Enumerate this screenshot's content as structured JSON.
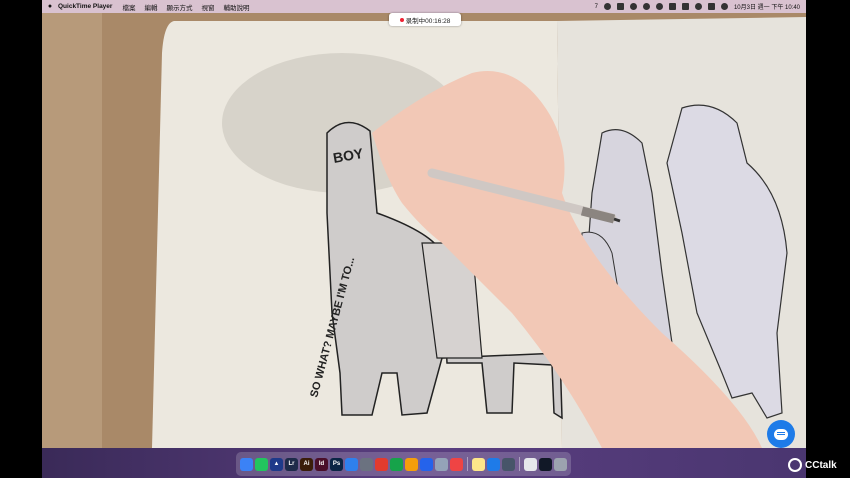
{
  "menubar": {
    "app_name": "QuickTime Player",
    "menus": [
      "檔案",
      "編輯",
      "顯示方式",
      "視窗",
      "輔助說明"
    ],
    "status_count": "7",
    "datetime": "10月3日 週一 下午 10:40"
  },
  "recording": {
    "label": "录制中00:16:28"
  },
  "drawing": {
    "lettering_top": "BOY",
    "lettering_side": "SO WHAT? MAYBE I'M TO..."
  },
  "dock": {
    "items": [
      {
        "name": "finder",
        "color": "#3b82f6",
        "glyph": ""
      },
      {
        "name": "wechat",
        "color": "#22c55e",
        "glyph": ""
      },
      {
        "name": "affinity",
        "color": "#1e3a8a",
        "glyph": "▲"
      },
      {
        "name": "lightroom",
        "color": "#1e2b4a",
        "glyph": "Lr"
      },
      {
        "name": "illustrator",
        "color": "#3a1d0a",
        "glyph": "Ai"
      },
      {
        "name": "indesign",
        "color": "#4a0f2a",
        "glyph": "Id"
      },
      {
        "name": "photoshop",
        "color": "#0b2545",
        "glyph": "Ps"
      },
      {
        "name": "safari",
        "color": "#2f80ed",
        "glyph": ""
      },
      {
        "name": "settings",
        "color": "#6b7280",
        "glyph": ""
      },
      {
        "name": "office",
        "color": "#e23b2e",
        "glyph": ""
      },
      {
        "name": "numbers",
        "color": "#16a34a",
        "glyph": ""
      },
      {
        "name": "charts",
        "color": "#f59e0b",
        "glyph": ""
      },
      {
        "name": "keynote",
        "color": "#2563eb",
        "glyph": ""
      },
      {
        "name": "preview",
        "color": "#94a3b8",
        "glyph": ""
      },
      {
        "name": "chrome",
        "color": "#ef4444",
        "glyph": ""
      },
      {
        "name": "notes",
        "color": "#fde68a",
        "glyph": ""
      },
      {
        "name": "cctalk-app",
        "color": "#1e7be8",
        "glyph": ""
      },
      {
        "name": "quicktime",
        "color": "#475569",
        "glyph": ""
      },
      {
        "name": "files",
        "color": "#e5e7eb",
        "glyph": ""
      },
      {
        "name": "terminal",
        "color": "#111827",
        "glyph": ""
      },
      {
        "name": "trash",
        "color": "#9ca3af",
        "glyph": ""
      }
    ]
  },
  "watermark": "CCtalk"
}
